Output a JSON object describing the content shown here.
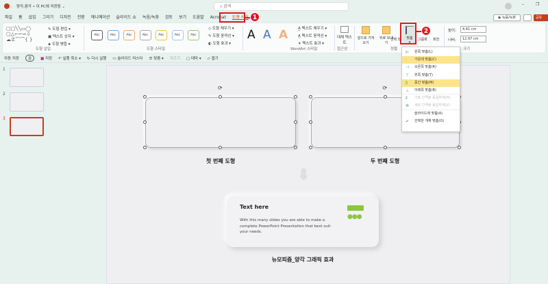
{
  "titlebar": {
    "doc_title": "양각,음각 • 이 PC에 저장됨 ⌄",
    "search_placeholder": "검색",
    "record_btn": "녹음/녹화",
    "share_btn": "공유"
  },
  "tabs": [
    "파일",
    "홈",
    "삽입",
    "그리기",
    "디자인",
    "전환",
    "애니메이션",
    "슬라이드 쇼",
    "녹음/녹화",
    "검토",
    "보기",
    "도움말",
    "Acrobat",
    "도형 서식"
  ],
  "ribbon": {
    "insert_shapes": {
      "label": "도형 삽입",
      "edit": "도형 편집",
      "textbox": "텍스트 상자",
      "merge": "도형 병합"
    },
    "shape_styles": {
      "label": "도형 스타일",
      "sample": "Abc",
      "fill": "도형 채우기",
      "outline": "도형 윤곽선",
      "effects": "도형 효과"
    },
    "wordart": {
      "label": "WordArt 스타일",
      "letter": "A",
      "fill": "텍스트 채우기",
      "outline": "텍스트 윤곽선",
      "effects": "텍스트 효과"
    },
    "accessibility": {
      "label": "접근성",
      "alt_text": "대체 텍스트"
    },
    "arrange": {
      "label": "정렬",
      "forward": "앞으로 가져오기",
      "backward": "뒤로 보내기",
      "selection": "선택 창",
      "align": "맞춤",
      "group": "그룹화",
      "rotate": "회전"
    },
    "size": {
      "label": "크기",
      "height_label": "높이:",
      "height": "4.41 cm",
      "width_label": "너비:",
      "width": "12.97 cm"
    }
  },
  "qat": {
    "autosave": "자동 저장",
    "toggle": "끔",
    "save": "저장",
    "undo": "실행 취소",
    "redo": "다시 실행",
    "master": "슬라이드 마스터",
    "align": "맞춤",
    "crop": "자르기",
    "theme": "테마",
    "open": "열기"
  },
  "thumbnails": [
    "1",
    "2",
    "3"
  ],
  "slide": {
    "shape1_label": "첫 번째 도형",
    "shape2_label": "두 번째 도형",
    "card_title": "Text here",
    "card_body": "With this many slides you are able to make a complete PowerPoint Presentation that best suit your needs.",
    "caption": "뉴모피즘_양각 그래픽 효과"
  },
  "align_menu": [
    {
      "label": "왼쪽 맞춤(L)",
      "icon": "align-left-icon",
      "state": "normal"
    },
    {
      "label": "가운데 맞춤(C)",
      "icon": "align-center-icon",
      "state": "highlight"
    },
    {
      "label": "오른쪽 맞춤(R)",
      "icon": "align-right-icon",
      "state": "normal"
    },
    {
      "label": "위쪽 맞춤(T)",
      "icon": "align-top-icon",
      "state": "normal"
    },
    {
      "label": "중간 맞춤(M)",
      "icon": "align-middle-icon",
      "state": "highlight"
    },
    {
      "label": "아래쪽 맞춤(B)",
      "icon": "align-bottom-icon",
      "state": "normal"
    },
    {
      "label": "가로 간격을 동일하게(H)",
      "icon": "distribute-h-icon",
      "state": "disabled"
    },
    {
      "label": "세로 간격을 동일하게(V)",
      "icon": "distribute-v-icon",
      "state": "disabled"
    },
    {
      "label": "슬라이드에 맞춤(A)",
      "icon": "",
      "state": "normal"
    },
    {
      "label": "선택한 개체 맞춤(O)",
      "icon": "check-icon",
      "state": "normal"
    }
  ],
  "annotations": [
    "1",
    "2"
  ],
  "colors": {
    "accent": "#c43e1c",
    "highlight": "#fde48a",
    "annotation": "#e0161e",
    "green": "#8cc63f"
  }
}
